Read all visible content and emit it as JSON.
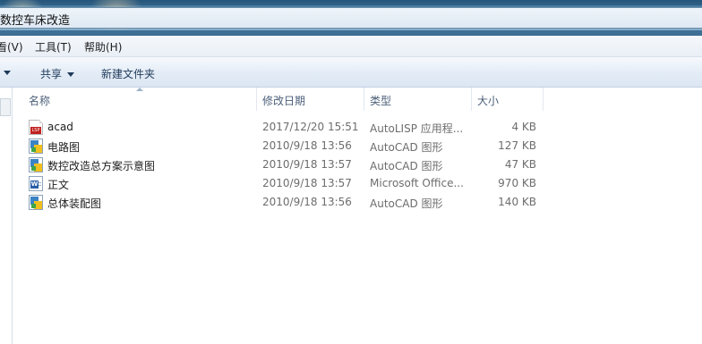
{
  "window": {
    "title_path": "数控车床改造"
  },
  "menubar": {
    "view": "看(V)",
    "tools": "工具(T)",
    "help": "帮助(H)"
  },
  "commandbar": {
    "share": "共享",
    "new_folder": "新建文件夹"
  },
  "columns": {
    "name": "名称",
    "date": "修改日期",
    "type": "类型",
    "size": "大小"
  },
  "files": [
    {
      "name": "acad",
      "date": "2017/12/20 15:51",
      "type": "AutoLISP 应用程...",
      "size": "4 KB",
      "icon": "lisp-file-icon"
    },
    {
      "name": "电路图",
      "date": "2010/9/18 13:56",
      "type": "AutoCAD 图形",
      "size": "127 KB",
      "icon": "dwg-file-icon"
    },
    {
      "name": "数控改造总方案示意图",
      "date": "2010/9/18 13:57",
      "type": "AutoCAD 图形",
      "size": "47 KB",
      "icon": "dwg-file-icon"
    },
    {
      "name": "正文",
      "date": "2010/9/18 13:57",
      "type": "Microsoft Office...",
      "size": "970 KB",
      "icon": "word-doc-icon"
    },
    {
      "name": "总体装配图",
      "date": "2010/9/18 13:56",
      "type": "AutoCAD 图形",
      "size": "140 KB",
      "icon": "dwg-file-icon"
    }
  ]
}
